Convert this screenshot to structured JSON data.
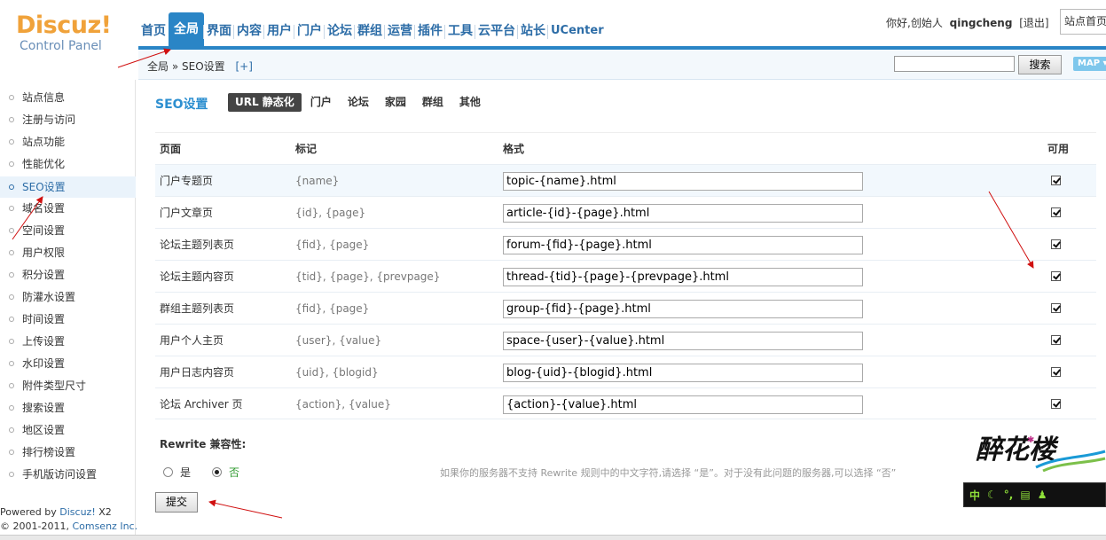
{
  "header": {
    "logo_main": "Discuz!",
    "logo_sub": "Control Panel",
    "nav": [
      "首页",
      "全局",
      "界面",
      "内容",
      "用户",
      "门户",
      "论坛",
      "群组",
      "运营",
      "插件",
      "工具",
      "云平台",
      "站长",
      "UCenter"
    ],
    "greeting": "你好,创始人",
    "username": "qingcheng",
    "logout": "[退出]",
    "site_select": "站点首页"
  },
  "subheader": {
    "crumb_root": "全局",
    "crumb_sep": "»",
    "crumb_current": "SEO设置",
    "crumb_add": "[+]",
    "search_value": "",
    "search_button": "搜索",
    "map_button": "MAP ▾"
  },
  "sidebar": {
    "items": [
      "站点信息",
      "注册与访问",
      "站点功能",
      "性能优化",
      "SEO设置",
      "域名设置",
      "空间设置",
      "用户权限",
      "积分设置",
      "防灌水设置",
      "时间设置",
      "上传设置",
      "水印设置",
      "附件类型尺寸",
      "搜索设置",
      "地区设置",
      "排行榜设置",
      "手机版访问设置"
    ],
    "active_index": 4,
    "powered_line1_prefix": "Powered by ",
    "powered_brand": "Discuz!",
    "powered_version": " X2",
    "powered_line2_prefix": "© 2001-2011, ",
    "powered_company": "Comsenz Inc."
  },
  "main": {
    "title": "SEO设置",
    "tabs": [
      "URL 静态化",
      "门户",
      "论坛",
      "家园",
      "群组",
      "其他"
    ],
    "active_tab": 0,
    "columns": {
      "page": "页面",
      "mark": "标记",
      "format": "格式",
      "enabled": "可用"
    },
    "rows": [
      {
        "page": "门户专题页",
        "mark": "{name}",
        "format": "topic-{name}.html",
        "enabled": true
      },
      {
        "page": "门户文章页",
        "mark": "{id}, {page}",
        "format": "article-{id}-{page}.html",
        "enabled": true
      },
      {
        "page": "论坛主题列表页",
        "mark": "{fid}, {page}",
        "format": "forum-{fid}-{page}.html",
        "enabled": true
      },
      {
        "page": "论坛主题内容页",
        "mark": "{tid}, {page}, {prevpage}",
        "format": "thread-{tid}-{page}-{prevpage}.html",
        "enabled": true
      },
      {
        "page": "群组主题列表页",
        "mark": "{fid}, {page}",
        "format": "group-{fid}-{page}.html",
        "enabled": true
      },
      {
        "page": "用户个人主页",
        "mark": "{user}, {value}",
        "format": "space-{user}-{value}.html",
        "enabled": true
      },
      {
        "page": "用户日志内容页",
        "mark": "{uid}, {blogid}",
        "format": "blog-{uid}-{blogid}.html",
        "enabled": true
      },
      {
        "page": "论坛 Archiver 页",
        "mark": "{action}, {value}",
        "format": "{action}-{value}.html",
        "enabled": true
      }
    ],
    "rewrite_label": "Rewrite 兼容性:",
    "radio_yes": "是",
    "radio_no": "否",
    "radio_selected": "否",
    "rewrite_tip": "如果你的服务器不支持 Rewrite 规则中的中文字符,请选择 “是”。对于没有此问题的服务器,可以选择 “否”",
    "submit": "提交"
  },
  "watermark": {
    "text": "醉花楼"
  },
  "ime": {
    "label": "中"
  },
  "colors": {
    "accent": "#2a85c6",
    "title": "#2d8fd0",
    "logo": "#f0a23a",
    "arrow": "#d01010"
  }
}
